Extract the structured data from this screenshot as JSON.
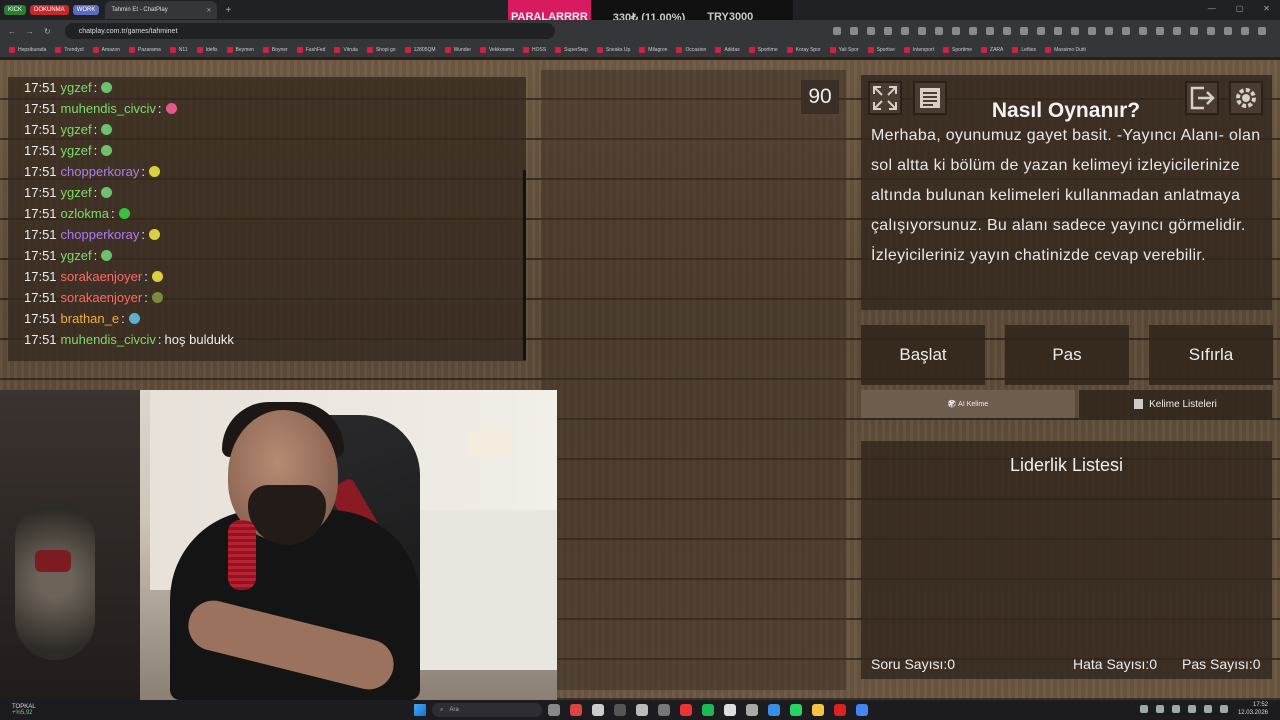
{
  "browser": {
    "pinned_tabs": [
      {
        "label": "KICK",
        "color": "#2e7d32"
      },
      {
        "label": "DOKUNMA",
        "color": "#c62828"
      },
      {
        "label": "WORK",
        "color": "#5c6bc0"
      }
    ],
    "active_tab": "Tahmin Et - ChatPlay",
    "url": "chatplay.com.tr/games/tahminet",
    "bookmarks": [
      "Hepsiburada",
      "Trendyol",
      "Amazon",
      "Pazarama",
      "N11",
      "Idefix",
      "Beymen",
      "Boyner",
      "FashFed",
      "Vitruta",
      "Shopi go",
      "12805QM",
      "Wunder",
      "Vekkorama",
      "HOSS",
      "SuperStep",
      "Sneaks Up",
      "Milagron",
      "Occasion",
      "Adidas",
      "Sportime",
      "Koray Spor",
      "Yali Spor",
      "Sportive",
      "Intersport",
      "Sportime",
      "ZARA",
      "Lefties",
      "Massimo Dutti"
    ]
  },
  "ticker": {
    "name": "PARALARRRR",
    "amount": "330₺ (11.00%)",
    "goal": "TRY3000"
  },
  "chat": {
    "messages": [
      {
        "time": "17:51",
        "user": "ygzef",
        "color": "#7ddc6a",
        "emote": "#6cc070",
        "text": ""
      },
      {
        "time": "17:51",
        "user": "muhendis_civciv",
        "color": "#7ddc6a",
        "emote": "#e05a8a",
        "text": ""
      },
      {
        "time": "17:51",
        "user": "ygzef",
        "color": "#7ddc6a",
        "emote": "#6cc070",
        "text": ""
      },
      {
        "time": "17:51",
        "user": "ygzef",
        "color": "#7ddc6a",
        "emote": "#6cc070",
        "text": ""
      },
      {
        "time": "17:51",
        "user": "chopperkoray",
        "color": "#b07cf0",
        "emote": "#d8d040",
        "text": ""
      },
      {
        "time": "17:51",
        "user": "ygzef",
        "color": "#7ddc6a",
        "emote": "#6cc070",
        "text": ""
      },
      {
        "time": "17:51",
        "user": "ozlokma",
        "color": "#7ddc6a",
        "emote": "#3cbf3c",
        "text": ""
      },
      {
        "time": "17:51",
        "user": "chopperkoray",
        "color": "#b07cf0",
        "emote": "#d8d040",
        "text": ""
      },
      {
        "time": "17:51",
        "user": "ygzef",
        "color": "#7ddc6a",
        "emote": "#6cc070",
        "text": ""
      },
      {
        "time": "17:51",
        "user": "sorakaenjoyer",
        "color": "#ff6b6b",
        "emote": "#d8d040",
        "text": ""
      },
      {
        "time": "17:51",
        "user": "sorakaenjoyer",
        "color": "#ff6b6b",
        "emote": "#7a8a40",
        "text": ""
      },
      {
        "time": "17:51",
        "user": "brathan_e",
        "color": "#f0b040",
        "emote": "#5ab0d0",
        "text": ""
      },
      {
        "time": "17:51",
        "user": "muhendis_civciv",
        "color": "#7ddc6a",
        "emote": "",
        "text": "hoş buldukk"
      }
    ]
  },
  "game": {
    "timer": "90",
    "howto_title": "Nasıl Oynanır?",
    "howto_text": "Merhaba, oyunumuz gayet basit. -Yayıncı Alanı- olan sol altta ki bölüm de yazan kelimeyi izleyicilerinize altında bulunan kelimeleri kullanmadan anlatmaya çalışıyorsunuz. Bu alanı sadece yayıncı görmelidir. İzleyicileriniz yayın chatinizde cevap verebilir.",
    "buttons": {
      "start": "Başlat",
      "pass": "Pas",
      "reset": "Sıfırla"
    },
    "ai_word": "🎲 AI Kelime",
    "word_lists": "Kelime Listeleri",
    "leaderboard_title": "Liderlik Listesi",
    "stats": {
      "questions": "Soru Sayısı:0",
      "errors": "Hata Sayısı:0",
      "passes": "Pas Sayısı:0"
    }
  },
  "taskbar": {
    "weather_label": "TOPKAL",
    "weather_value": "+%5,92",
    "search_placeholder": "Ara",
    "time": "17:52",
    "date": "12.03.2026"
  },
  "colors": {
    "accent": "#d81b60",
    "wood": "#6e5a44",
    "panel": "#34281e"
  }
}
